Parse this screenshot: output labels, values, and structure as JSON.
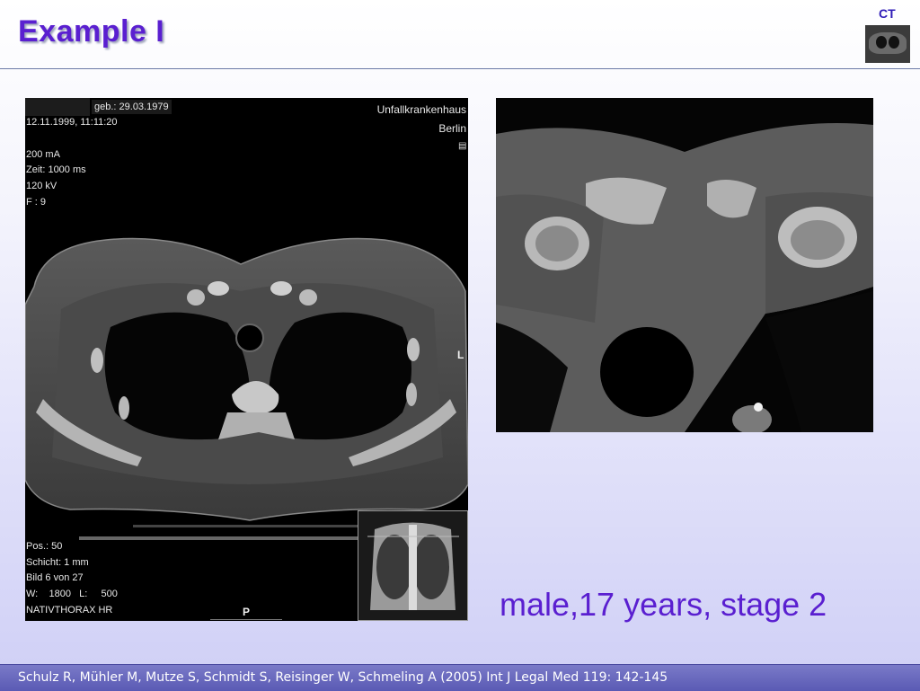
{
  "slide": {
    "title": "Example I",
    "badge": "CT",
    "caption": "male,17 years, stage 2",
    "footer": "Schulz R, Mühler M, Mutze S, Schmidt S, Reisinger W, Schmeling A (2005) Int J Legal Med 119: 142-145"
  },
  "scan_overlay": {
    "birth": "geb.: 29.03.1979",
    "datetime": "12.11.1999, 11:11:20",
    "hospital_line1": "Unfallkrankenhaus",
    "hospital_line2": "Berlin",
    "params": [
      "200 mA",
      "Zeit: 1000 ms",
      "120 kV",
      "F : 9"
    ],
    "bottom": [
      "Pos.: 50",
      "Schicht: 1 mm",
      "Bild 6 von 27",
      "W:    1800   L:     500",
      "NATIVTHORAX HR"
    ],
    "orientation_left": "L",
    "orientation_bottom": "P"
  }
}
